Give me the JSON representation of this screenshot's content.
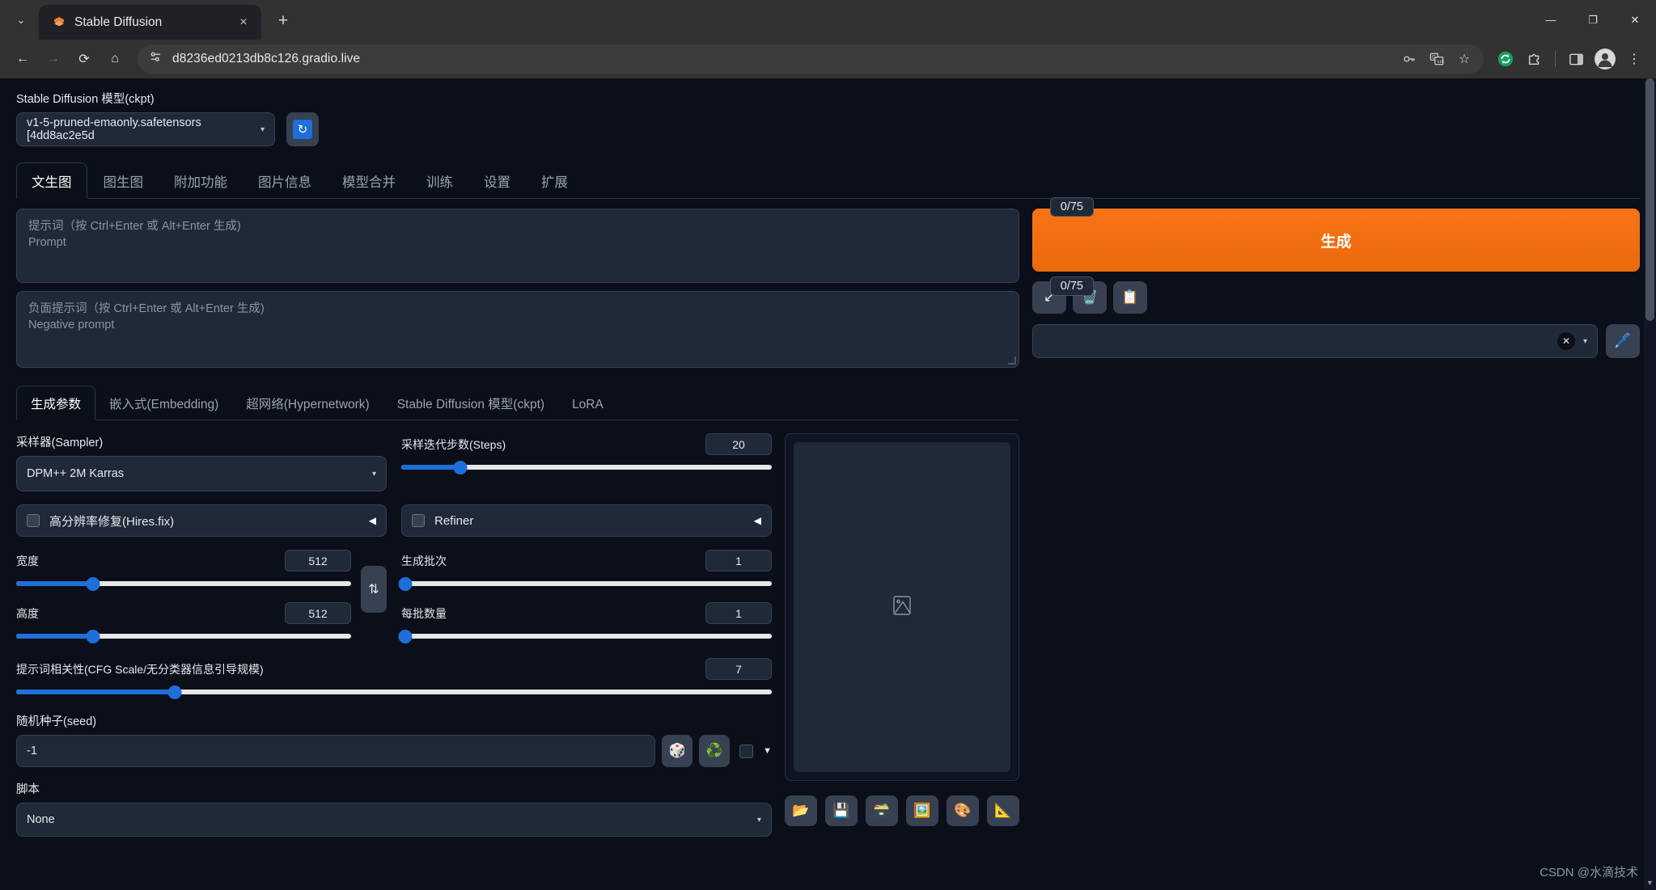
{
  "browser": {
    "tab": {
      "title": "Stable Diffusion",
      "favicon": "stable-diffusion-logo-icon",
      "close": "×"
    },
    "new_tab": "+",
    "tab_list": "⌄",
    "window": {
      "minimize": "—",
      "maximize": "❐",
      "close": "✕"
    },
    "nav": {
      "back": "←",
      "forward": "→",
      "reload": "⟳",
      "home": "⌂"
    },
    "omnibox": {
      "url": "d8236ed0213db8c126.gradio.live",
      "site_info_icon": "page-settings-icon"
    },
    "omni_actions": {
      "password": "⚷",
      "translate": "文",
      "bookmark": "☆"
    },
    "toolbar_icons": {
      "sync": "↻",
      "extensions": "⧉",
      "sidebar": "◫",
      "profile": "●",
      "menu": "⋮"
    }
  },
  "model": {
    "label": "Stable Diffusion 模型(ckpt)",
    "value": "v1-5-pruned-emaonly.safetensors [4dd8ac2e5d",
    "caret": "▾",
    "refresh_icon": "↻"
  },
  "tabs": [
    {
      "label": "文生图",
      "active": true
    },
    {
      "label": "图生图",
      "active": false
    },
    {
      "label": "附加功能",
      "active": false
    },
    {
      "label": "图片信息",
      "active": false
    },
    {
      "label": "模型合并",
      "active": false
    },
    {
      "label": "训练",
      "active": false
    },
    {
      "label": "设置",
      "active": false
    },
    {
      "label": "扩展",
      "active": false
    }
  ],
  "prompt": {
    "placeholder_cn": "提示词（按 Ctrl+Enter 或 Alt+Enter 生成)",
    "placeholder_en": "Prompt",
    "value": "",
    "counter": "0/75"
  },
  "negative_prompt": {
    "placeholder_cn": "负面提示词（按 Ctrl+Enter 或 Alt+Enter 生成)",
    "placeholder_en": "Negative prompt",
    "value": "",
    "counter": "0/75"
  },
  "generate": {
    "label": "生成",
    "color": "#f97316",
    "mini_buttons": [
      {
        "name": "read-generation-params-button",
        "icon": "↙"
      },
      {
        "name": "clear-prompt-button",
        "icon": "🗑️"
      },
      {
        "name": "apply-style-button",
        "icon": "📋"
      }
    ],
    "styles": {
      "value": "",
      "clear_icon": "✕",
      "caret": "▾"
    },
    "edit_styles_icon": "🖊️"
  },
  "subtabs": [
    {
      "label": "生成参数",
      "active": true
    },
    {
      "label": "嵌入式(Embedding)",
      "active": false
    },
    {
      "label": "超网络(Hypernetwork)",
      "active": false
    },
    {
      "label": "Stable Diffusion 模型(ckpt)",
      "active": false
    },
    {
      "label": "LoRA",
      "active": false
    }
  ],
  "params": {
    "sampler": {
      "label": "采样器(Sampler)",
      "value": "DPM++ 2M Karras",
      "caret": "▾"
    },
    "steps": {
      "label": "采样迭代步数(Steps)",
      "value": "20",
      "percent": 16
    },
    "hires_fix": {
      "label": "高分辨率修复(Hires.fix)",
      "checked": false,
      "arrow": "◀"
    },
    "refiner": {
      "label": "Refiner",
      "checked": false,
      "arrow": "◀"
    },
    "width": {
      "label": "宽度",
      "value": "512",
      "percent": 23
    },
    "height": {
      "label": "高度",
      "value": "512",
      "percent": 23
    },
    "swap_icon": "⇅",
    "batch_count": {
      "label": "生成批次",
      "value": "1",
      "percent": 1
    },
    "batch_size": {
      "label": "每批数量",
      "value": "1",
      "percent": 1
    },
    "cfg_scale": {
      "label": "提示词相关性(CFG Scale/无分类器信息引导规模)",
      "value": "7",
      "percent": 21
    },
    "seed": {
      "label": "随机种子(seed)",
      "value": "-1",
      "dice_icon": "🎲",
      "recycle_icon": "♻️",
      "extra_checked": false,
      "caret": "▼"
    },
    "script": {
      "label": "脚本",
      "value": "None",
      "caret": "▾"
    }
  },
  "output": {
    "placeholder_icon": "image-placeholder-icon",
    "toolbar": [
      {
        "name": "open-folder-button",
        "icon": "📂"
      },
      {
        "name": "save-button",
        "icon": "💾"
      },
      {
        "name": "save-zip-button",
        "icon": "🗃️"
      },
      {
        "name": "send-to-img2img-button",
        "icon": "🖼️"
      },
      {
        "name": "send-to-inpaint-button",
        "icon": "🎨"
      },
      {
        "name": "send-to-extras-button",
        "icon": "📐"
      }
    ]
  },
  "watermark": "CSDN @水滴技术"
}
